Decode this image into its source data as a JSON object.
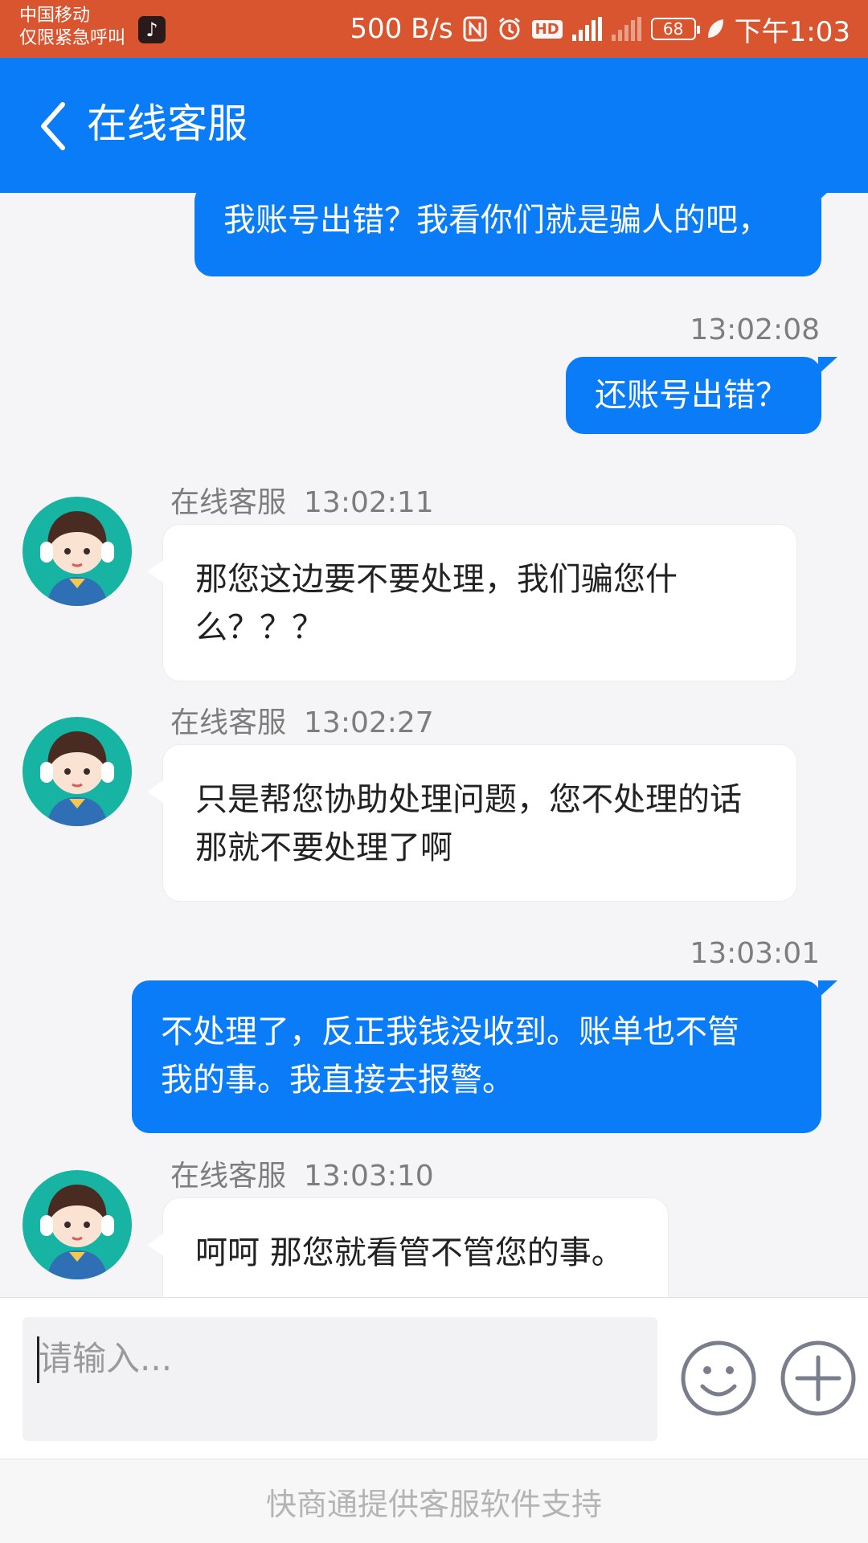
{
  "status_bar": {
    "carrier_line1": "中国移动",
    "carrier_line2": "仅限紧急呼叫",
    "net_speed": "500 B/s",
    "battery": "68",
    "time": "下午1:03",
    "icons": [
      "tiktok-icon",
      "nfc-icon",
      "alarm-icon",
      "hd-icon",
      "4g-signal-icon",
      "no-sim-signal-icon",
      "battery-icon",
      "leaf-icon"
    ]
  },
  "header": {
    "title": "在线客服",
    "back_icon": "chevron-left-icon"
  },
  "messages": [
    {
      "side": "right",
      "text": "我账号出错？我看你们就是骗人的吧，"
    },
    {
      "side": "right",
      "time": "13:02:08",
      "text": "还账号出错？"
    },
    {
      "side": "left",
      "sender": "在线客服",
      "time": "13:02:11",
      "lines": [
        "那您这边要不要处理，我们骗您什",
        "么？？？"
      ]
    },
    {
      "side": "left",
      "sender": "在线客服",
      "time": "13:02:27",
      "lines": [
        "只是帮您协助处理问题，您不处理的话",
        "那就不要处理了啊"
      ]
    },
    {
      "side": "right",
      "time": "13:03:01",
      "lines": [
        "不处理了，反正我钱没收到。账单也不管",
        "我的事。我直接去报警。"
      ]
    },
    {
      "side": "left",
      "sender": "在线客服",
      "time": "13:03:10",
      "text": "呵呵 那您就看管不管您的事。"
    }
  ],
  "input": {
    "placeholder": "请输入...",
    "emoji_icon": "smiley-icon",
    "plus_icon": "plus-circle-icon"
  },
  "footer": {
    "text": "快商通提供客服软件支持"
  },
  "colors": {
    "status_bar": "#d9552f",
    "header": "#0a7cf7",
    "bubble_right": "#0a7cf7",
    "bubble_left": "#ffffff",
    "background": "#f5f4f6"
  }
}
